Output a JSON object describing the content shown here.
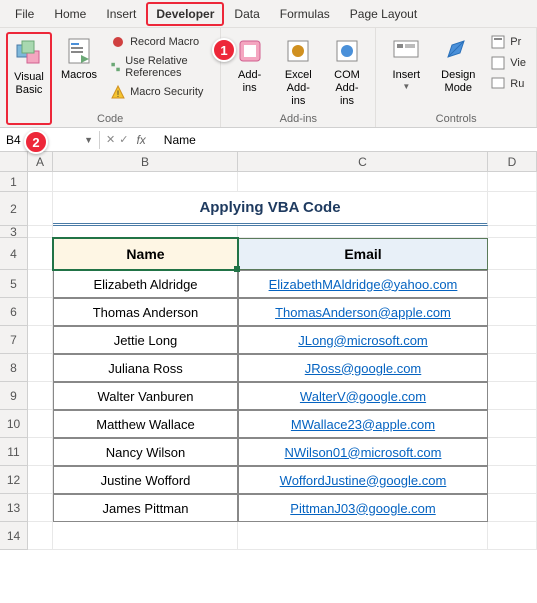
{
  "menubar": {
    "items": [
      "File",
      "Home",
      "Insert",
      "Developer",
      "Data",
      "Formulas",
      "Page Layout"
    ],
    "active": "Developer"
  },
  "ribbon": {
    "group1_label": "Code",
    "group2_label": "Add-ins",
    "group3_label": "Controls",
    "visual_basic": "Visual\nBasic",
    "macros": "Macros",
    "record_macro": "Record Macro",
    "use_relative": "Use Relative References",
    "macro_security": "Macro Security",
    "addins": "Add-\nins",
    "excel_addins": "Excel\nAdd-ins",
    "com_addins": "COM\nAdd-ins",
    "insert": "Insert",
    "design_mode": "Design\nMode",
    "properties": "Pr",
    "view_code": "Vie",
    "run_dialog": "Ru"
  },
  "callouts": {
    "one": "1",
    "two": "2"
  },
  "namebox": "B4",
  "formula_fx": "fx",
  "formula_content": "Name",
  "columns": [
    "A",
    "B",
    "C",
    "D"
  ],
  "rows": [
    "1",
    "2",
    "3",
    "4",
    "5",
    "6",
    "7",
    "8",
    "9",
    "10",
    "11",
    "12",
    "13",
    "14"
  ],
  "title": "Applying VBA Code",
  "headers": {
    "name": "Name",
    "email": "Email"
  },
  "table": [
    {
      "name": "Elizabeth Aldridge",
      "email": "ElizabethMAldridge@yahoo.com"
    },
    {
      "name": "Thomas Anderson",
      "email": "ThomasAnderson@apple.com"
    },
    {
      "name": "Jettie Long",
      "email": "JLong@microsoft.com"
    },
    {
      "name": "Juliana Ross",
      "email": "JRoss@google.com"
    },
    {
      "name": "Walter Vanburen",
      "email": "WalterV@google.com"
    },
    {
      "name": "Matthew Wallace",
      "email": "MWallace23@apple.com"
    },
    {
      "name": "Nancy Wilson",
      "email": "NWilson01@microsoft.com"
    },
    {
      "name": "Justine Wofford",
      "email": "WoffordJustine@google.com"
    },
    {
      "name": "James Pittman",
      "email": "PittmanJ03@google.com"
    }
  ]
}
